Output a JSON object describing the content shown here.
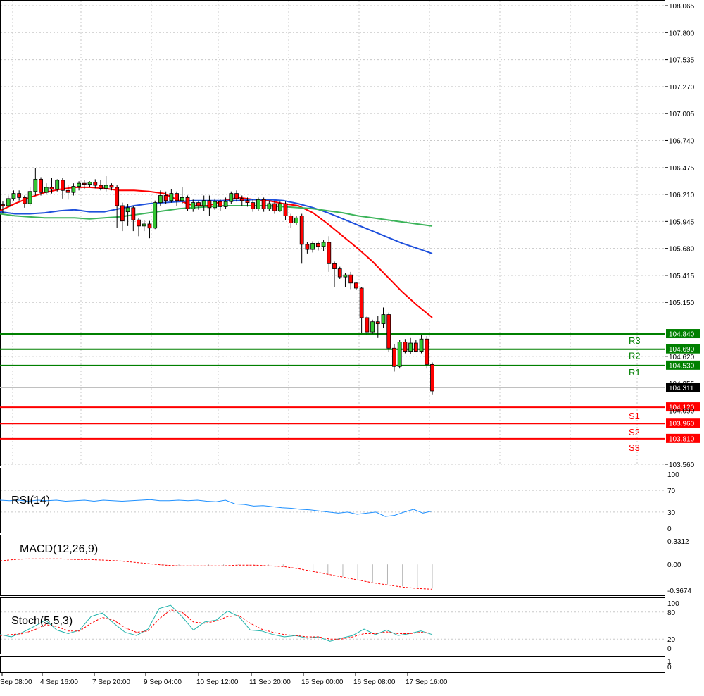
{
  "chart_data": {
    "type": "candlestick",
    "price_axis": {
      "ylim": [
        103.56,
        108.065
      ],
      "ticks": [
        "108.065",
        "107.800",
        "107.535",
        "107.270",
        "107.005",
        "106.740",
        "106.475",
        "106.210",
        "105.945",
        "105.680",
        "105.415",
        "105.150",
        "104.620",
        "103.560"
      ],
      "partial_ticks": [
        "104.355",
        "104.090"
      ]
    },
    "time_axis": {
      "labels": [
        "Sep 08:00",
        "4 Sep 16:00",
        "7 Sep 20:00",
        "9 Sep 04:00",
        "10 Sep 12:00",
        "11 Sep 20:00",
        "15 Sep 00:00",
        "16 Sep 08:00",
        "17 Sep 16:00"
      ]
    },
    "current_price": "104.311",
    "levels": [
      {
        "name": "R3",
        "value": "104.840",
        "color": "#008000"
      },
      {
        "name": "R2",
        "value": "104.690",
        "color": "#008000"
      },
      {
        "name": "R1",
        "value": "104.530",
        "color": "#008000"
      },
      {
        "name": "S1",
        "value": "104.120",
        "color": "#ff0000"
      },
      {
        "name": "S2",
        "value": "103.960",
        "color": "#ff0000"
      },
      {
        "name": "S3",
        "value": "103.810",
        "color": "#ff0000"
      }
    ],
    "candles": [
      [
        106.11,
        106.1,
        106.14,
        106.03
      ],
      [
        106.1,
        106.17,
        106.2,
        106.08
      ],
      [
        106.17,
        106.22,
        106.25,
        106.15
      ],
      [
        106.22,
        106.18,
        106.25,
        106.15
      ],
      [
        106.18,
        106.12,
        106.2,
        106.08
      ],
      [
        106.12,
        106.24,
        106.28,
        106.1
      ],
      [
        106.24,
        106.36,
        106.47,
        106.2
      ],
      [
        106.36,
        106.23,
        106.38,
        106.2
      ],
      [
        106.23,
        106.28,
        106.32,
        106.21
      ],
      [
        106.28,
        106.26,
        106.37,
        106.22
      ],
      [
        106.26,
        106.35,
        106.36,
        106.24
      ],
      [
        106.35,
        106.25,
        106.37,
        106.17
      ],
      [
        106.25,
        106.23,
        106.3,
        106.16
      ],
      [
        106.23,
        106.29,
        106.32,
        106.2
      ],
      [
        106.29,
        106.32,
        106.34,
        106.25
      ],
      [
        106.32,
        106.31,
        106.35,
        106.26
      ],
      [
        106.31,
        106.33,
        106.34,
        106.28
      ],
      [
        106.33,
        106.3,
        106.36,
        106.27
      ],
      [
        106.3,
        106.27,
        106.35,
        106.25
      ],
      [
        106.27,
        106.3,
        106.39,
        106.24
      ],
      [
        106.3,
        106.28,
        106.32,
        106.25
      ],
      [
        106.28,
        106.1,
        106.3,
        105.88
      ],
      [
        106.1,
        105.95,
        106.13,
        105.85
      ],
      [
        106.04,
        106.08,
        106.12,
        105.9
      ],
      [
        106.08,
        105.96,
        106.1,
        105.85
      ],
      [
        105.96,
        105.9,
        105.98,
        105.8
      ],
      [
        105.9,
        105.92,
        105.96,
        105.85
      ],
      [
        105.92,
        105.88,
        105.95,
        105.78
      ],
      [
        105.88,
        106.13,
        106.15,
        105.87
      ],
      [
        106.13,
        106.2,
        106.25,
        106.1
      ],
      [
        106.2,
        106.15,
        106.24,
        106.12
      ],
      [
        106.15,
        106.22,
        106.26,
        106.13
      ],
      [
        106.22,
        106.15,
        106.24,
        106.1
      ],
      [
        106.15,
        106.18,
        106.28,
        106.12
      ],
      [
        106.18,
        106.07,
        106.2,
        106.05
      ],
      [
        106.07,
        106.13,
        106.16,
        106.04
      ],
      [
        106.13,
        106.1,
        106.15,
        106.06
      ],
      [
        106.1,
        106.15,
        106.2,
        106.05
      ],
      [
        106.15,
        106.08,
        106.2,
        106.0
      ],
      [
        106.08,
        106.14,
        106.17,
        106.06
      ],
      [
        106.14,
        106.09,
        106.16,
        106.05
      ],
      [
        106.09,
        106.14,
        106.18,
        106.07
      ],
      [
        106.14,
        106.22,
        106.24,
        106.12
      ],
      [
        106.22,
        106.17,
        106.25,
        106.14
      ],
      [
        106.17,
        106.15,
        106.2,
        106.1
      ],
      [
        106.15,
        106.13,
        106.18,
        106.09
      ],
      [
        106.13,
        106.07,
        106.16,
        106.04
      ],
      [
        106.07,
        106.16,
        106.18,
        106.05
      ],
      [
        106.16,
        106.07,
        106.18,
        106.04
      ],
      [
        106.07,
        106.12,
        106.15,
        106.05
      ],
      [
        106.12,
        106.05,
        106.15,
        106.02
      ],
      [
        106.05,
        106.12,
        106.14,
        106.04
      ],
      [
        106.12,
        106.0,
        106.14,
        105.96
      ],
      [
        106.0,
        105.93,
        106.02,
        105.88
      ],
      [
        105.93,
        105.98,
        106.0,
        105.91
      ],
      [
        106.0,
        105.72,
        106.02,
        105.53
      ],
      [
        105.72,
        105.67,
        105.74,
        105.63
      ],
      [
        105.67,
        105.73,
        105.75,
        105.64
      ],
      [
        105.73,
        105.7,
        105.75,
        105.66
      ],
      [
        105.7,
        105.74,
        105.76,
        105.65
      ],
      [
        105.74,
        105.53,
        105.8,
        105.45
      ],
      [
        105.53,
        105.48,
        105.55,
        105.3
      ],
      [
        105.48,
        105.4,
        105.5,
        105.38
      ],
      [
        105.4,
        105.42,
        105.44,
        105.3
      ],
      [
        105.42,
        105.34,
        105.45,
        105.28
      ],
      [
        105.34,
        105.29,
        105.35,
        105.27
      ],
      [
        105.29,
        105.0,
        105.3,
        104.85
      ],
      [
        105.0,
        104.86,
        105.02,
        104.83
      ],
      [
        104.86,
        104.96,
        104.98,
        104.84
      ],
      [
        104.96,
        104.94,
        105.02,
        104.8
      ],
      [
        104.94,
        105.03,
        105.1,
        104.9
      ],
      [
        105.03,
        104.7,
        105.05,
        104.66
      ],
      [
        104.7,
        104.52,
        104.74,
        104.47
      ],
      [
        104.52,
        104.76,
        104.78,
        104.5
      ],
      [
        104.76,
        104.67,
        104.79,
        104.65
      ],
      [
        104.67,
        104.75,
        104.8,
        104.64
      ],
      [
        104.75,
        104.67,
        104.78,
        104.66
      ],
      [
        104.67,
        104.79,
        104.83,
        104.65
      ],
      [
        104.79,
        104.54,
        104.82,
        104.5
      ],
      [
        104.54,
        104.28,
        104.56,
        104.24
      ]
    ],
    "moving_averages": [
      {
        "color": "#ff0000",
        "values": [
          106.05,
          106.12,
          106.18,
          106.23,
          106.26,
          106.28,
          106.28,
          106.27,
          106.25,
          106.25,
          106.24,
          106.22,
          106.15,
          106.1,
          106.1,
          106.15,
          106.18,
          106.16,
          106.15,
          106.12,
          106.1,
          106.03,
          105.92,
          105.8,
          105.68,
          105.55,
          105.4,
          105.25,
          105.12,
          105.0
        ]
      },
      {
        "color": "#1e50dc",
        "values": [
          106.04,
          106.02,
          106.02,
          106.03,
          106.05,
          106.06,
          106.04,
          106.04,
          106.07,
          106.1,
          106.12,
          106.13,
          106.14,
          106.15,
          106.15,
          106.15,
          106.15,
          106.16,
          106.16,
          106.15,
          106.12,
          106.08,
          106.03,
          105.97,
          105.91,
          105.85,
          105.79,
          105.73,
          105.68,
          105.63
        ]
      },
      {
        "color": "#3cb45a",
        "values": [
          106.02,
          106.0,
          105.99,
          105.98,
          105.98,
          105.98,
          105.97,
          105.98,
          105.99,
          106.01,
          106.03,
          106.05,
          106.07,
          106.08,
          106.09,
          106.1,
          106.1,
          106.1,
          106.1,
          106.09,
          106.08,
          106.07,
          106.05,
          106.03,
          106.0,
          105.98,
          105.96,
          105.94,
          105.92,
          105.9
        ]
      }
    ],
    "rsi": {
      "title": "RSI(14)",
      "ticks": [
        "100",
        "70",
        "30",
        "0"
      ],
      "values": [
        52,
        51,
        52,
        50,
        52,
        51,
        52,
        50,
        51,
        52,
        50,
        52,
        51,
        50,
        51,
        52,
        53,
        51,
        51,
        52,
        51,
        52,
        50,
        49,
        52,
        45,
        44,
        41,
        42,
        40,
        38,
        37,
        35,
        34,
        32,
        30,
        28,
        30,
        26,
        28,
        30,
        22,
        24,
        30,
        35,
        28,
        32
      ]
    },
    "macd": {
      "title": "MACD(12,26,9)",
      "ticks": [
        "0.3312",
        "0.00",
        "-0.3674"
      ],
      "signal": [
        0.05,
        0.07,
        0.08,
        0.08,
        0.08,
        0.07,
        0.07,
        0.06,
        0.05,
        0.03,
        0.01,
        -0.01,
        -0.02,
        -0.02,
        -0.02,
        -0.02,
        -0.01,
        -0.01,
        -0.02,
        -0.03,
        -0.06,
        -0.1,
        -0.14,
        -0.18,
        -0.22,
        -0.26,
        -0.29,
        -0.32,
        -0.34,
        -0.35
      ]
    },
    "stoch": {
      "title": "Stoch(5,5,3)",
      "ticks": [
        "100",
        "80",
        "20",
        "0"
      ],
      "k": [
        30,
        25,
        35,
        48,
        62,
        40,
        32,
        40,
        70,
        78,
        55,
        35,
        28,
        42,
        88,
        95,
        70,
        40,
        58,
        62,
        82,
        70,
        40,
        38,
        30,
        25,
        28,
        22,
        25,
        15,
        22,
        28,
        42,
        30,
        40,
        28,
        32,
        38,
        30
      ],
      "d": [
        28,
        30,
        32,
        40,
        52,
        48,
        38,
        38,
        55,
        68,
        62,
        45,
        35,
        38,
        65,
        85,
        80,
        58,
        55,
        60,
        70,
        72,
        55,
        42,
        35,
        30,
        28,
        25,
        25,
        20,
        20,
        25,
        32,
        32,
        36,
        32,
        32,
        35,
        33
      ]
    },
    "sub_axes": [
      {
        "ticks": [
          "1",
          "0"
        ]
      }
    ]
  }
}
